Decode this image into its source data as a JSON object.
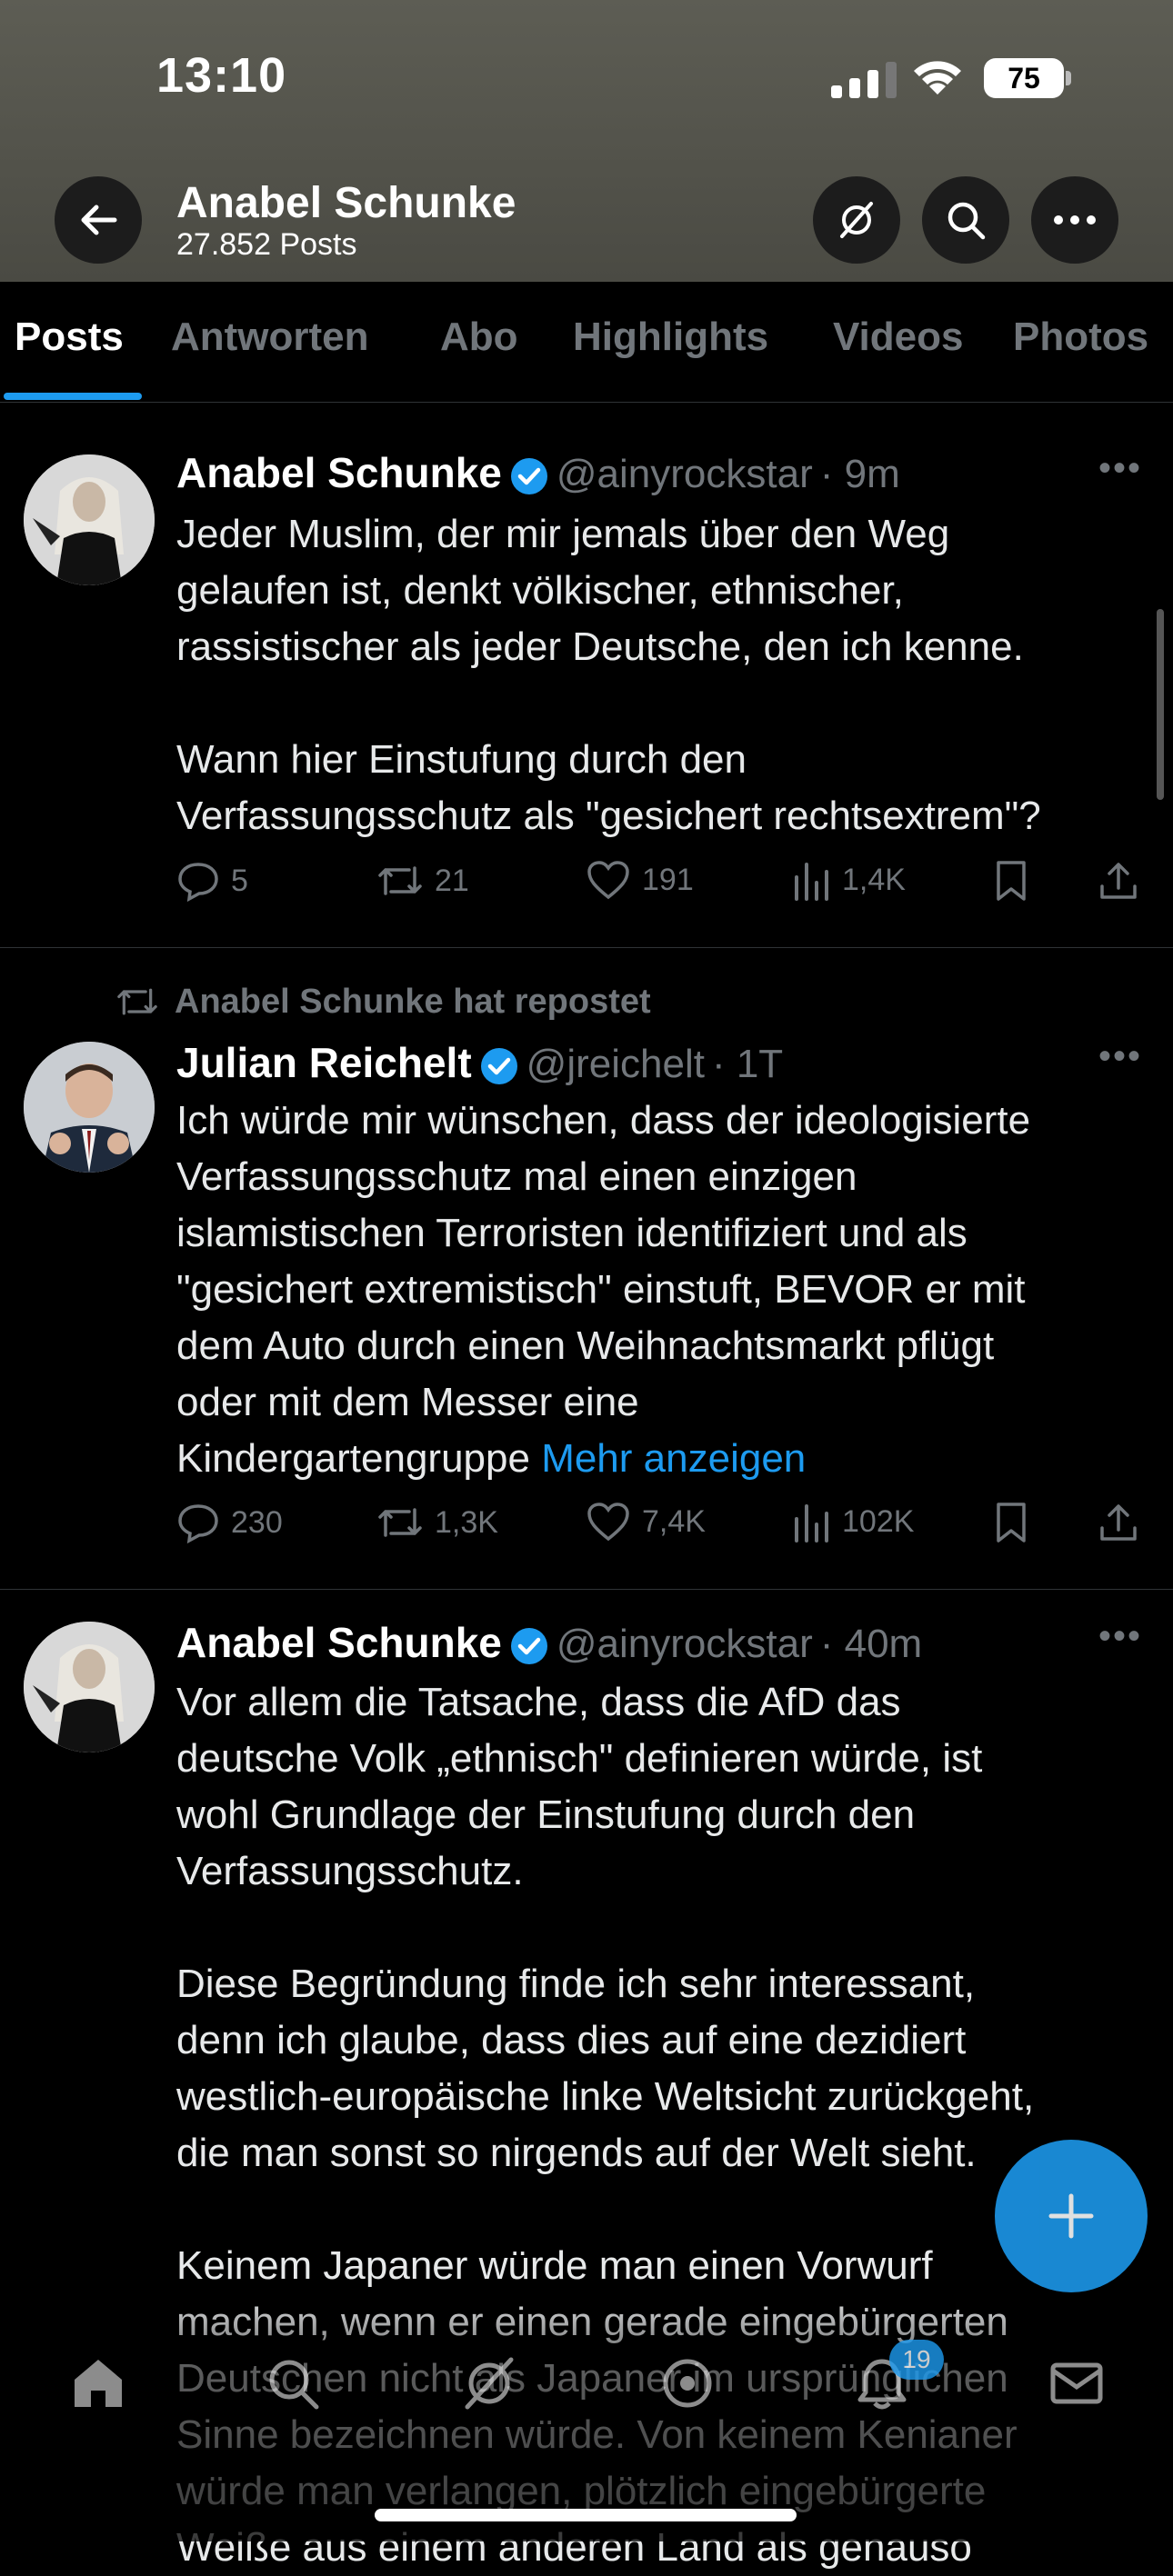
{
  "status_bar": {
    "time": "13:10",
    "battery": "75"
  },
  "header": {
    "title": "Anabel Schunke",
    "subtitle": "27.852 Posts"
  },
  "tabs": [
    {
      "label": "Posts",
      "active": true
    },
    {
      "label": "Antworten",
      "active": false
    },
    {
      "label": "Abo",
      "active": false
    },
    {
      "label": "Highlights",
      "active": false
    },
    {
      "label": "Videos",
      "active": false
    },
    {
      "label": "Photos",
      "active": false
    }
  ],
  "posts": [
    {
      "name": "Anabel Schunke",
      "handle": "@ainyrockstar",
      "time": "· 9m",
      "text": "Jeder Muslim, der mir jemals über den Weg\ngelaufen ist, denkt völkischer, ethnischer,\nrassistischer als jeder Deutsche, den ich kenne.\n\nWann hier Einstufung durch den\nVerfassungsschutz als \"gesichert rechtsextrem\"?",
      "replies": "5",
      "reposts": "21",
      "likes": "191",
      "views": "1,4K"
    },
    {
      "repost_label": "Anabel Schunke hat repostet",
      "name": "Julian Reichelt",
      "handle": "@jreichelt",
      "time": "· 1T",
      "text": "Ich würde mir wünschen, dass der ideologisierte\nVerfassungsschutz mal einen einzigen\nislamistischen Terroristen identifiziert und als\n\"gesichert extremistisch\" einstuft, BEVOR er mit\ndem Auto durch einen Weihnachtsmarkt pflügt\noder mit dem Messer eine\nKindergartengruppe ",
      "show_more": "Mehr anzeigen",
      "replies": "230",
      "reposts": "1,3K",
      "likes": "7,4K",
      "views": "102K"
    },
    {
      "name": "Anabel Schunke",
      "handle": "@ainyrockstar",
      "time": "· 40m",
      "text": "Vor allem die Tatsache, dass die AfD das\ndeutsche Volk „ethnisch\" definieren würde, ist\nwohl Grundlage der Einstufung durch den\nVerfassungsschutz.\n\nDiese Begründung finde ich sehr interessant,\ndenn ich glaube, dass dies auf eine dezidiert\nwestlich-europäische linke Weltsicht zurückgeht,\ndie man sonst so nirgends auf der Welt sieht.\n\nKeinem Japaner würde man einen Vorwurf\nmachen, wenn er einen gerade eingebürgerten\nDeutschen nicht als Japaner im ursprünglichen\nSinne bezeichnen würde. Von keinem Kenianer\nwürde man verlangen, plötzlich eingebürgerte\nWeiße aus einem anderen Land als genauso"
    }
  ],
  "notifications_badge": "19",
  "colors": {
    "accent": "#1d9bf0",
    "muted": "#71767b",
    "background": "#000000"
  }
}
